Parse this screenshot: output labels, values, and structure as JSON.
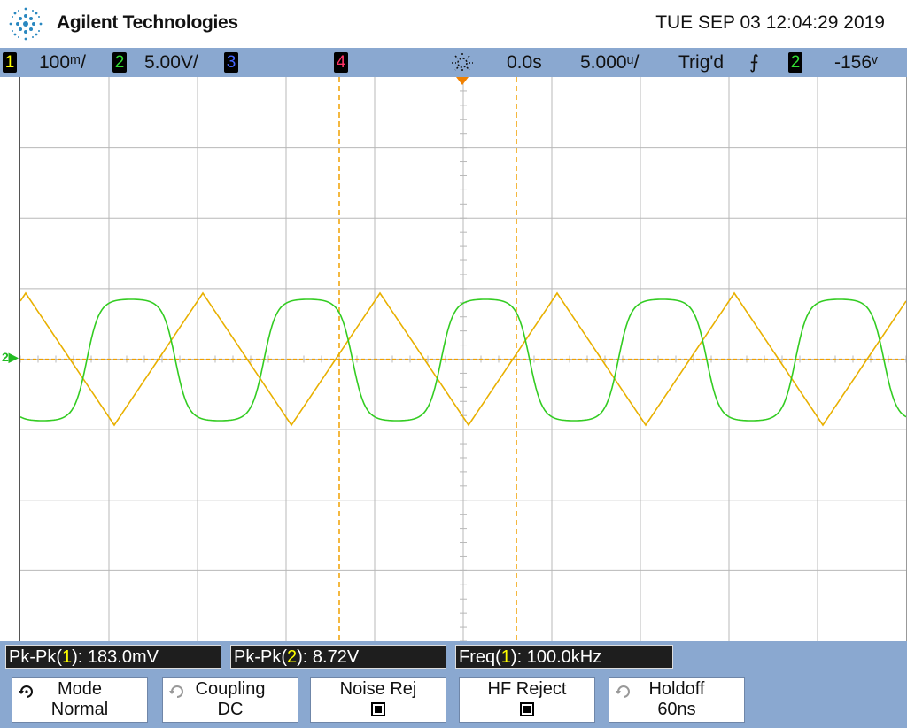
{
  "header": {
    "brand": "Agilent Technologies",
    "datetime": "TUE SEP 03 12:04:29 2019"
  },
  "status": {
    "ch1_num": "1",
    "ch1_scale": "100ᵐ/",
    "ch2_num": "2",
    "ch2_scale": "5.00V/",
    "ch3_num": "3",
    "ch4_num": "4",
    "delay": "0.0s",
    "timebase": "5.000ᵘ/",
    "trig_status": "Trig'd",
    "trig_slope": "⨍",
    "trig_source": "2",
    "trig_level": "-156ᵛ"
  },
  "colors": {
    "ch1": "#ffff00",
    "ch2": "#33dd33",
    "ch3": "#4466ff",
    "ch4": "#ff3366",
    "trace1": "#e8b000",
    "trace2": "#33cc22",
    "cursor": "#f0a000",
    "background": "#8aa8d0"
  },
  "measurements": [
    {
      "label_pre": "Pk-Pk(",
      "ch": "1",
      "label_post": "): 183.0mV"
    },
    {
      "label_pre": "Pk-Pk(",
      "ch": "2",
      "label_post": "): 8.72V"
    },
    {
      "label_pre": "Freq(",
      "ch": "1",
      "label_post": "): 100.0kHz"
    }
  ],
  "softkeys": [
    {
      "line1": "Mode",
      "line2": "Normal",
      "icon": "rotate-knob-icon"
    },
    {
      "line1": "Coupling",
      "line2": "DC",
      "icon": "rotate-knob-icon"
    },
    {
      "line1": "Noise Rej",
      "line2": "",
      "icon": "checkbox"
    },
    {
      "line1": "HF Reject",
      "line2": "",
      "icon": "checkbox"
    },
    {
      "line1": "Holdoff",
      "line2": "60ns",
      "icon": "rotate-knob-icon"
    }
  ],
  "chart_data": {
    "type": "line",
    "title": "",
    "xlabel": "",
    "ylabel": "",
    "x_divisions": 10,
    "y_divisions": 8,
    "time_per_div_us": 5,
    "series": [
      {
        "name": "1",
        "shape": "triangle",
        "frequency_khz": 100,
        "pk_pk_mv": 183,
        "color": "#e8b000"
      },
      {
        "name": "2",
        "shape": "rounded-square",
        "frequency_khz": 100,
        "pk_pk_v": 8.72,
        "color": "#33cc22"
      }
    ]
  }
}
